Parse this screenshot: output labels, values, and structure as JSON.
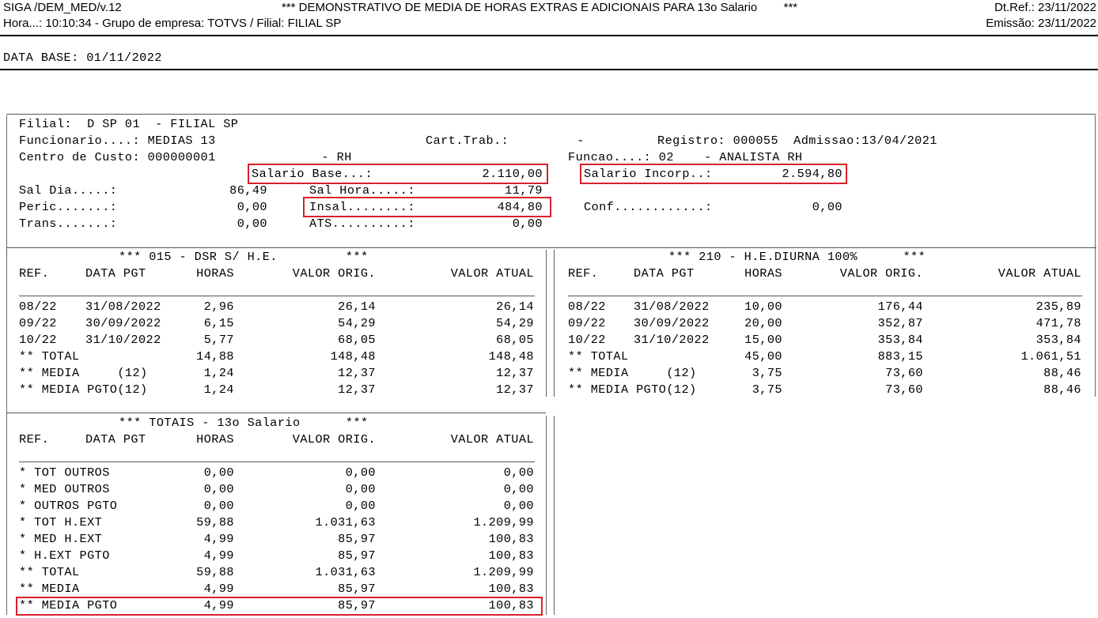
{
  "header": {
    "left_line1": "SIGA /DEM_MED/v.12",
    "title": "*** DEMONSTRATIVO DE MEDIA DE HORAS EXTRAS E ADICIONAIS PARA 13o Salario        ***",
    "right_line1": "Dt.Ref.: 23/11/2022",
    "left_line2": "Hora...: 10:10:34 - Grupo de empresa: TOTVS / Filial: FILIAL SP",
    "right_line2": "Emissão: 23/11/2022"
  },
  "data_base": "DATA BASE: 01/11/2022",
  "employee": {
    "filial": "Filial:  D SP 01  - FILIAL SP",
    "funcionario": "Funcionario....: MEDIAS 13",
    "cart_trab": "Cart.Trab.:         -",
    "registro": "Registro: 000055  Admissao:13/04/2021",
    "centro_custo": "Centro de Custo: 000000001              - RH",
    "funcao": "Funcao....: 02    - ANALISTA RH",
    "salario_base_label": "Salario Base...:",
    "salario_base_value": "2.110,00",
    "salario_incorp_label": "Salario Incorp..:",
    "salario_incorp_value": "2.594,80",
    "sal_dia_label": "Sal Dia.....:",
    "sal_dia_value": "86,49",
    "sal_hora_label": "Sal Hora.....:",
    "sal_hora_value": "11,79",
    "peric_label": "Peric.......:",
    "peric_value": "0,00",
    "insal_label": "Insal........:",
    "insal_value": "484,80",
    "conf_label": "Conf............:",
    "conf_value": "0,00",
    "trans_label": "Trans.......:",
    "trans_value": "0,00",
    "ats_label": "ATS..........:",
    "ats_value": "0,00"
  },
  "columns": [
    "REF.",
    "DATA PGT",
    "HORAS",
    "VALOR ORIG.",
    "VALOR ATUAL"
  ],
  "section_dsr": {
    "title": "*** 015 - DSR S/ H.E.         ***",
    "rows": [
      [
        "08/22",
        "31/08/2022",
        "2,96",
        "26,14",
        "26,14"
      ],
      [
        "09/22",
        "30/09/2022",
        "6,15",
        "54,29",
        "54,29"
      ],
      [
        "10/22",
        "31/10/2022",
        "5,77",
        "68,05",
        "68,05"
      ],
      [
        "** TOTAL",
        "",
        "14,88",
        "148,48",
        "148,48"
      ],
      [
        "** MEDIA     (12)",
        "",
        "1,24",
        "12,37",
        "12,37"
      ],
      [
        "** MEDIA PGTO(12)",
        "",
        "1,24",
        "12,37",
        "12,37"
      ]
    ]
  },
  "section_he": {
    "title": "*** 210 - H.E.DIURNA 100%      ***",
    "rows": [
      [
        "08/22",
        "31/08/2022",
        "10,00",
        "176,44",
        "235,89"
      ],
      [
        "09/22",
        "30/09/2022",
        "20,00",
        "352,87",
        "471,78"
      ],
      [
        "10/22",
        "31/10/2022",
        "15,00",
        "353,84",
        "353,84"
      ],
      [
        "** TOTAL",
        "",
        "45,00",
        "883,15",
        "1.061,51"
      ],
      [
        "** MEDIA     (12)",
        "",
        "3,75",
        "73,60",
        "88,46"
      ],
      [
        "** MEDIA PGTO(12)",
        "",
        "3,75",
        "73,60",
        "88,46"
      ]
    ]
  },
  "section_totais": {
    "title": "*** TOTAIS - 13o Salario      ***",
    "rows": [
      [
        "* TOT OUTROS",
        "",
        "0,00",
        "0,00",
        "0,00"
      ],
      [
        "* MED OUTROS",
        "",
        "0,00",
        "0,00",
        "0,00"
      ],
      [
        "* OUTROS PGTO",
        "",
        "0,00",
        "0,00",
        "0,00"
      ],
      [
        "* TOT H.EXT",
        "",
        "59,88",
        "1.031,63",
        "1.209,99"
      ],
      [
        "* MED H.EXT",
        "",
        "4,99",
        "85,97",
        "100,83"
      ],
      [
        "* H.EXT PGTO",
        "",
        "4,99",
        "85,97",
        "100,83"
      ],
      [
        "** TOTAL",
        "",
        "59,88",
        "1.031,63",
        "1.209,99"
      ],
      [
        "** MEDIA",
        "",
        "4,99",
        "85,97",
        "100,83"
      ],
      [
        "** MEDIA PGTO",
        "",
        "4,99",
        "85,97",
        "100,83"
      ]
    ]
  },
  "highlight_color": "#d9202a"
}
